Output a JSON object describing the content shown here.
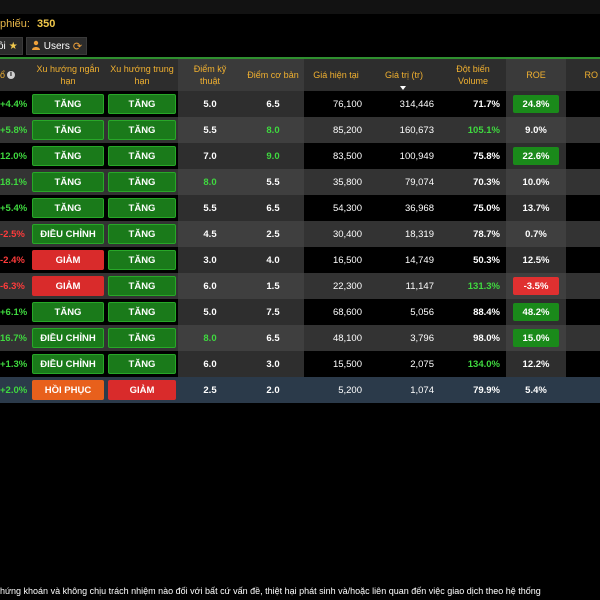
{
  "header": {
    "count_label": "phiếu:",
    "count_value": "350"
  },
  "tabs": [
    {
      "label": "ồi",
      "icon": "star-icon"
    },
    {
      "label": "Users",
      "icon": "users-icon",
      "trailing_icon": "refresh-icon"
    }
  ],
  "columns": {
    "change": "ổ",
    "short_trend": "Xu hướng ngắn hạn",
    "mid_trend": "Xu hướng trung hạn",
    "tech_score": "Điểm kỹ thuật",
    "fund_score": "Điểm cơ bản",
    "price": "Giá hiện tại",
    "value": "Giá trị (tr)",
    "volume_spike": "Đột biến Volume",
    "roe": "ROE",
    "roe2": "RO"
  },
  "rows": [
    {
      "change": "+4.4%",
      "short": "TĂNG",
      "mid": "TĂNG",
      "tech": "5.0",
      "fund": "6.5",
      "price": "76,100",
      "value": "314,446",
      "spike": "71.7%",
      "roe": "24.8%"
    },
    {
      "change": "+5.8%",
      "short": "TĂNG",
      "mid": "TĂNG",
      "tech": "5.5",
      "fund": "8.0",
      "price": "85,200",
      "value": "160,673",
      "spike": "105.1%",
      "roe": "9.0%"
    },
    {
      "change": "12.0%",
      "short": "TĂNG",
      "mid": "TĂNG",
      "tech": "7.0",
      "fund": "9.0",
      "price": "83,500",
      "value": "100,949",
      "spike": "75.8%",
      "roe": "22.6%"
    },
    {
      "change": "18.1%",
      "short": "TĂNG",
      "mid": "TĂNG",
      "tech": "8.0",
      "fund": "5.5",
      "price": "35,800",
      "value": "79,074",
      "spike": "70.3%",
      "roe": "10.0%"
    },
    {
      "change": "+5.4%",
      "short": "TĂNG",
      "mid": "TĂNG",
      "tech": "5.5",
      "fund": "6.5",
      "price": "54,300",
      "value": "36,968",
      "spike": "75.0%",
      "roe": "13.7%"
    },
    {
      "change": "-2.5%",
      "short": "ĐIỀU CHỈNH",
      "mid": "TĂNG",
      "tech": "4.5",
      "fund": "2.5",
      "price": "30,400",
      "value": "18,319",
      "spike": "78.7%",
      "roe": "0.7%"
    },
    {
      "change": "-2.4%",
      "short": "GIẢM",
      "mid": "TĂNG",
      "tech": "3.0",
      "fund": "4.0",
      "price": "16,500",
      "value": "14,749",
      "spike": "50.3%",
      "roe": "12.5%"
    },
    {
      "change": "-6.3%",
      "short": "GIẢM",
      "mid": "TĂNG",
      "tech": "6.0",
      "fund": "1.5",
      "price": "22,300",
      "value": "11,147",
      "spike": "131.3%",
      "roe": "-3.5%"
    },
    {
      "change": "+6.1%",
      "short": "TĂNG",
      "mid": "TĂNG",
      "tech": "5.0",
      "fund": "7.5",
      "price": "68,600",
      "value": "5,056",
      "spike": "88.4%",
      "roe": "48.2%"
    },
    {
      "change": "16.7%",
      "short": "ĐIỀU CHỈNH",
      "mid": "TĂNG",
      "tech": "8.0",
      "fund": "6.5",
      "price": "48,100",
      "value": "3,796",
      "spike": "98.0%",
      "roe": "15.0%"
    },
    {
      "change": "+1.3%",
      "short": "ĐIỀU CHỈNH",
      "mid": "TĂNG",
      "tech": "6.0",
      "fund": "3.0",
      "price": "15,500",
      "value": "2,075",
      "spike": "134.0%",
      "roe": "12.2%"
    },
    {
      "change": "+2.0%",
      "short": "HỒI PHỤC",
      "mid": "GIẢM",
      "tech": "2.5",
      "fund": "2.0",
      "price": "5,200",
      "value": "1,074",
      "spike": "79.9%",
      "roe": "5.4%"
    }
  ],
  "footer": {
    "disclaimer": "hứng khoán và không chịu trách nhiệm nào đối với bất cứ vấn đề, thiệt hại phát sinh và/hoặc liên quan đến việc giao dịch theo hệ thống"
  },
  "colors": {
    "accent_orange": "#f0b030",
    "up_green": "#3fd83f",
    "down_red": "#ff3b3b",
    "pill_green": "#1a7a1a",
    "pill_red": "#d92b2b",
    "pill_orange": "#e8601c"
  }
}
